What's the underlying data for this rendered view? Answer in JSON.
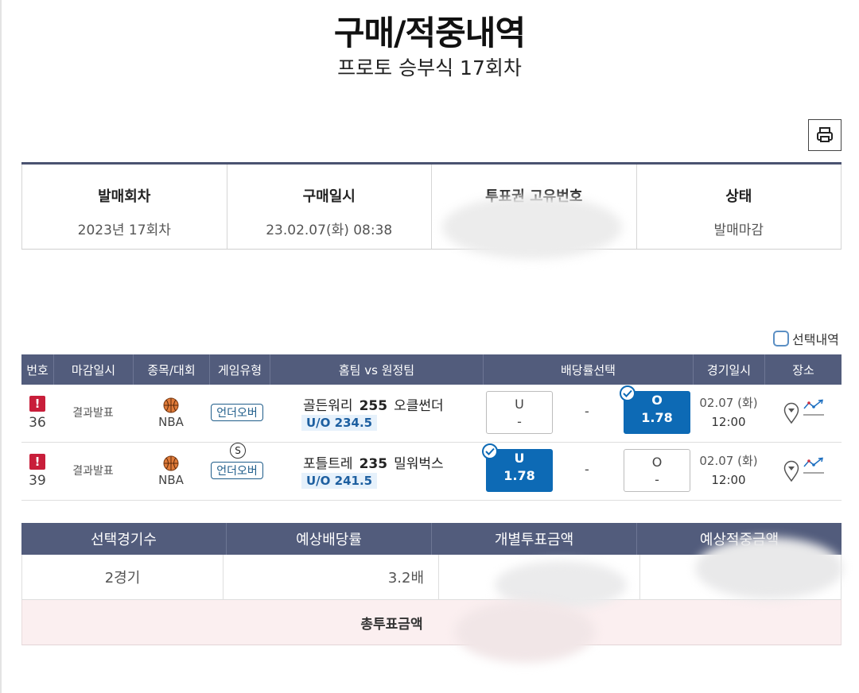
{
  "header": {
    "title": "구매/적중내역",
    "subtitle": "프로토 승부식 17회차"
  },
  "toolbar": {
    "print_icon": "printer-icon"
  },
  "info": {
    "round_label": "발매회차",
    "round_value": "2023년 17회차",
    "purchase_label": "구매일시",
    "purchase_value": "23.02.07(화) 08:38",
    "ticket_label": "투표권 고유번호",
    "ticket_value": "",
    "status_label": "상태",
    "status_value": "발매마감"
  },
  "selection": {
    "label": "선택내역"
  },
  "games_table": {
    "columns": [
      "번호",
      "마감일시",
      "종목/대회",
      "게임유형",
      "홈팀 vs 원정팀",
      "배당률선택",
      "경기일시",
      "장소"
    ],
    "rows": [
      {
        "number": "36",
        "close_status": "결과발표",
        "league": "NBA",
        "sport_icon": "basketball-icon",
        "game_type": "언더오버",
        "home": "골든워리",
        "line": "255",
        "away": "오클썬더",
        "uo_label": "U/O 234.5",
        "odds_under": {
          "pick": "U",
          "value": "-"
        },
        "odds_draw": "-",
        "odds_over": {
          "pick": "O",
          "value": "1.78"
        },
        "selected": "over",
        "date": "02.07 (화)",
        "time": "12:00"
      },
      {
        "number": "39",
        "close_status": "결과발표",
        "league": "NBA",
        "sport_icon": "basketball-icon",
        "special_badge": "S",
        "game_type": "언더오버",
        "home": "포틀트레",
        "line": "235",
        "away": "밀워벅스",
        "uo_label": "U/O 241.5",
        "odds_under": {
          "pick": "U",
          "value": "1.78"
        },
        "odds_draw": "-",
        "odds_over": {
          "pick": "O",
          "value": "-"
        },
        "selected": "under",
        "date": "02.07 (화)",
        "time": "12:00"
      }
    ]
  },
  "summary": {
    "columns": [
      "선택경기수",
      "예상배당률",
      "개별투표금액",
      "예상적중금액"
    ],
    "games_count": "2경기",
    "expected_odds": "3.2배",
    "bet_amount": "",
    "expected_win": "",
    "total_label": "총투표금액",
    "total_value": ""
  },
  "colors": {
    "header_bg": "#525c7c",
    "selected_odds": "#0d6ab5",
    "alert": "#c81e3a",
    "total_bg": "#fbeff0"
  }
}
